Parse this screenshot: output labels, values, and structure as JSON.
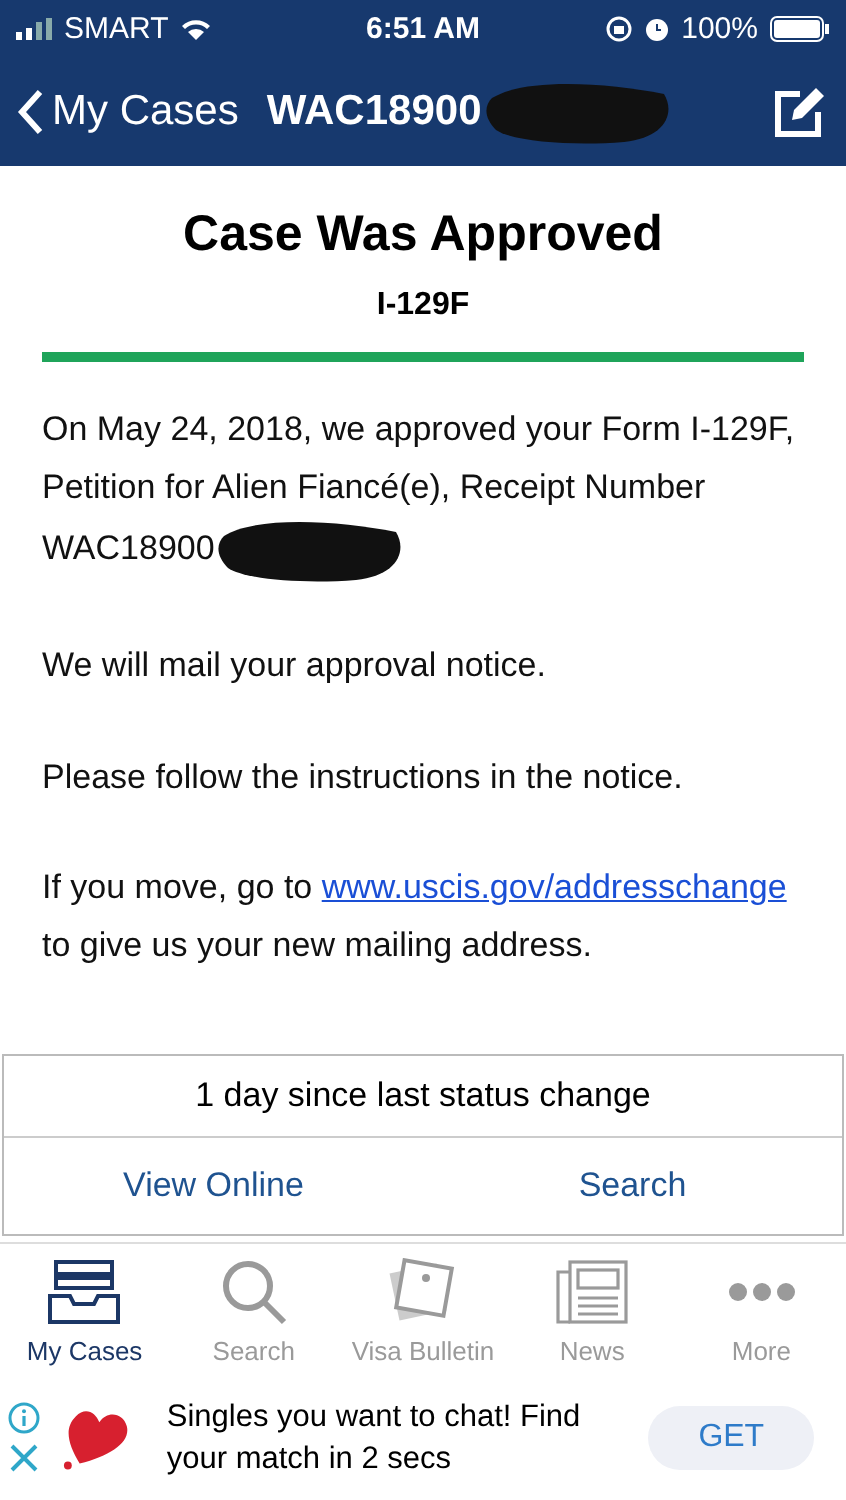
{
  "status_bar": {
    "carrier": "SMART",
    "time": "6:51 AM",
    "battery": "100%"
  },
  "nav_bar": {
    "back_label": "My Cases",
    "title": "WAC18900"
  },
  "case": {
    "title": "Case Was Approved",
    "form": "I-129F",
    "paragraphs": [
      {
        "text": "On May 24, 2018, we approved your Form I-129F, Petition for Alien Fiancé(e), Receipt Number",
        "case_number": "WAC18900"
      },
      {
        "text": "We will mail your approval notice."
      },
      {
        "text": "Please follow the instructions in the notice."
      },
      {
        "text": "If you move, go to",
        "link": "www.uscis.gov/addresschange",
        "after": "to give us your new mailing address."
      }
    ]
  },
  "status_change": "1 day since last status change",
  "actions": [
    "View Online",
    "Search"
  ],
  "tabs": [
    {
      "label": "My Cases",
      "selected": true
    },
    {
      "label": "Search",
      "selected": false
    },
    {
      "label": "Visa Bulletin",
      "selected": false
    },
    {
      "label": "News",
      "selected": false
    },
    {
      "label": "More",
      "selected": false
    }
  ],
  "ad": {
    "text": "Singles you want to chat! Find your match in 2 secs",
    "button": "GET"
  }
}
